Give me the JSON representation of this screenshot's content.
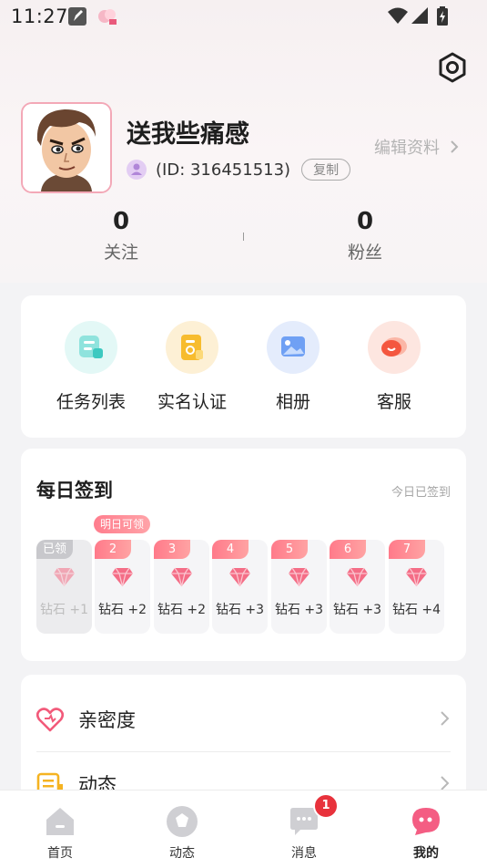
{
  "status_bar": {
    "time": "11:27"
  },
  "profile": {
    "username": "送我些痛感",
    "id_text": "(ID: 316451513)",
    "copy_label": "复制",
    "edit_label": "编辑资料"
  },
  "stats": [
    {
      "value": "0",
      "label": "关注"
    },
    {
      "value": "0",
      "label": "粉丝"
    }
  ],
  "quick_actions": [
    {
      "label": "任务列表",
      "icon": "task-list-icon",
      "color": "#3cc9c0"
    },
    {
      "label": "实名认证",
      "icon": "id-verify-icon",
      "color": "#f5b321"
    },
    {
      "label": "相册",
      "icon": "album-icon",
      "color": "#4f8cf0"
    },
    {
      "label": "客服",
      "icon": "customer-service-icon",
      "color": "#f4573f"
    }
  ],
  "sign_in": {
    "title": "每日签到",
    "status": "今日已签到",
    "tomorrow_label": "明日可领",
    "days": [
      {
        "tag": "已领",
        "reward": "钻石 +1"
      },
      {
        "tag": "2",
        "reward": "钻石 +2"
      },
      {
        "tag": "3",
        "reward": "钻石 +2"
      },
      {
        "tag": "4",
        "reward": "钻石 +3"
      },
      {
        "tag": "5",
        "reward": "钻石 +3"
      },
      {
        "tag": "6",
        "reward": "钻石 +3"
      },
      {
        "tag": "7",
        "reward": "钻石 +4"
      }
    ]
  },
  "menu": [
    {
      "label": "亲密度",
      "icon": "heart-icon"
    },
    {
      "label": "动态",
      "icon": "feed-icon"
    }
  ],
  "bottom_nav": [
    {
      "label": "首页",
      "icon": "home-icon"
    },
    {
      "label": "动态",
      "icon": "moments-icon"
    },
    {
      "label": "消息",
      "icon": "message-icon",
      "badge": "1"
    },
    {
      "label": "我的",
      "icon": "profile-icon",
      "active": true
    }
  ],
  "colors": {
    "accent": "#f25a7a",
    "badge": "#e8323c"
  }
}
